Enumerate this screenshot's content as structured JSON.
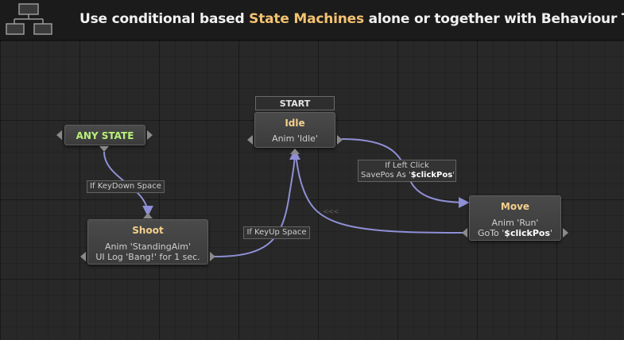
{
  "banner": {
    "text_before": "Use conditional based ",
    "text_highlight": "State Machines",
    "text_after": " alone or together with Behaviour Trees"
  },
  "icon": "flowchart-icon",
  "start_label": "START",
  "nodes": {
    "any_state": {
      "title": "ANY STATE"
    },
    "idle": {
      "title": "Idle",
      "line1": "Anim 'Idle'"
    },
    "shoot": {
      "title": "Shoot",
      "line1": "Anim 'StandingAim'",
      "line2": "UI Log 'Bang!' for 1 sec."
    },
    "move": {
      "title": "Move",
      "line1": "Anim 'Run'",
      "line2_prefix": "GoTo '",
      "line2_var": "$clickPos",
      "line2_suffix": "'"
    }
  },
  "transitions": {
    "keydown": "If KeyDown Space",
    "keyup": "If KeyUp Space",
    "leftclick_line1": "If Left Click",
    "leftclick_line2_prefix": "SavePos As '",
    "leftclick_line2_var": "$clickPos",
    "leftclick_line2_suffix": "'"
  },
  "colors": {
    "link": "#8f8fd6",
    "title_gold": "#f4d08c",
    "any_state_green": "#b8f07a",
    "highlight": "#f4c270"
  }
}
